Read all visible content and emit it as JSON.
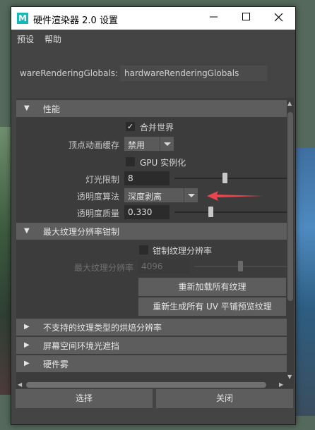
{
  "window": {
    "title": "硬件渲染器 2.0 设置",
    "app_icon_letter": "M"
  },
  "menubar": {
    "items": [
      "预设",
      "帮助"
    ]
  },
  "node": {
    "label": "wareRenderingGlobals:",
    "value": "hardwareRenderingGlobals"
  },
  "performance": {
    "title": "性能",
    "consolidate_world": {
      "label": "合并世界",
      "checked": true
    },
    "vertex_anim_cache": {
      "label": "顶点动画缓存",
      "value": "禁用"
    },
    "gpu_instancing": {
      "label": "GPU 实例化",
      "checked": false
    },
    "light_limit": {
      "label": "灯光限制",
      "value": "8",
      "slider_fraction": 0.5
    },
    "transparency_algorithm": {
      "label": "透明度算法",
      "value": "深度剥离"
    },
    "transparency_quality": {
      "label": "透明度质量",
      "value": "0.330",
      "slider_fraction": 0.33
    }
  },
  "max_texture": {
    "title": "最大纹理分辨率钳制",
    "clamp": {
      "label": "钳制纹理分辨率",
      "checked": false
    },
    "max_resolution": {
      "label": "最大纹理分辨率",
      "value": "4096",
      "slider_fraction": 0.5
    },
    "reload_button": "重新加载所有纹理",
    "regen_button": "重新生成所有 UV 平铺预览纹理"
  },
  "collapsed_sections": [
    "不支持的纹理类型的烘焙分辨率",
    "屏幕空间环境光遮挡",
    "硬件雾"
  ],
  "buttons": {
    "select": "选择",
    "close": "关闭"
  },
  "colors": {
    "arrow": "#e8454f",
    "icon": "#17b6b8"
  }
}
